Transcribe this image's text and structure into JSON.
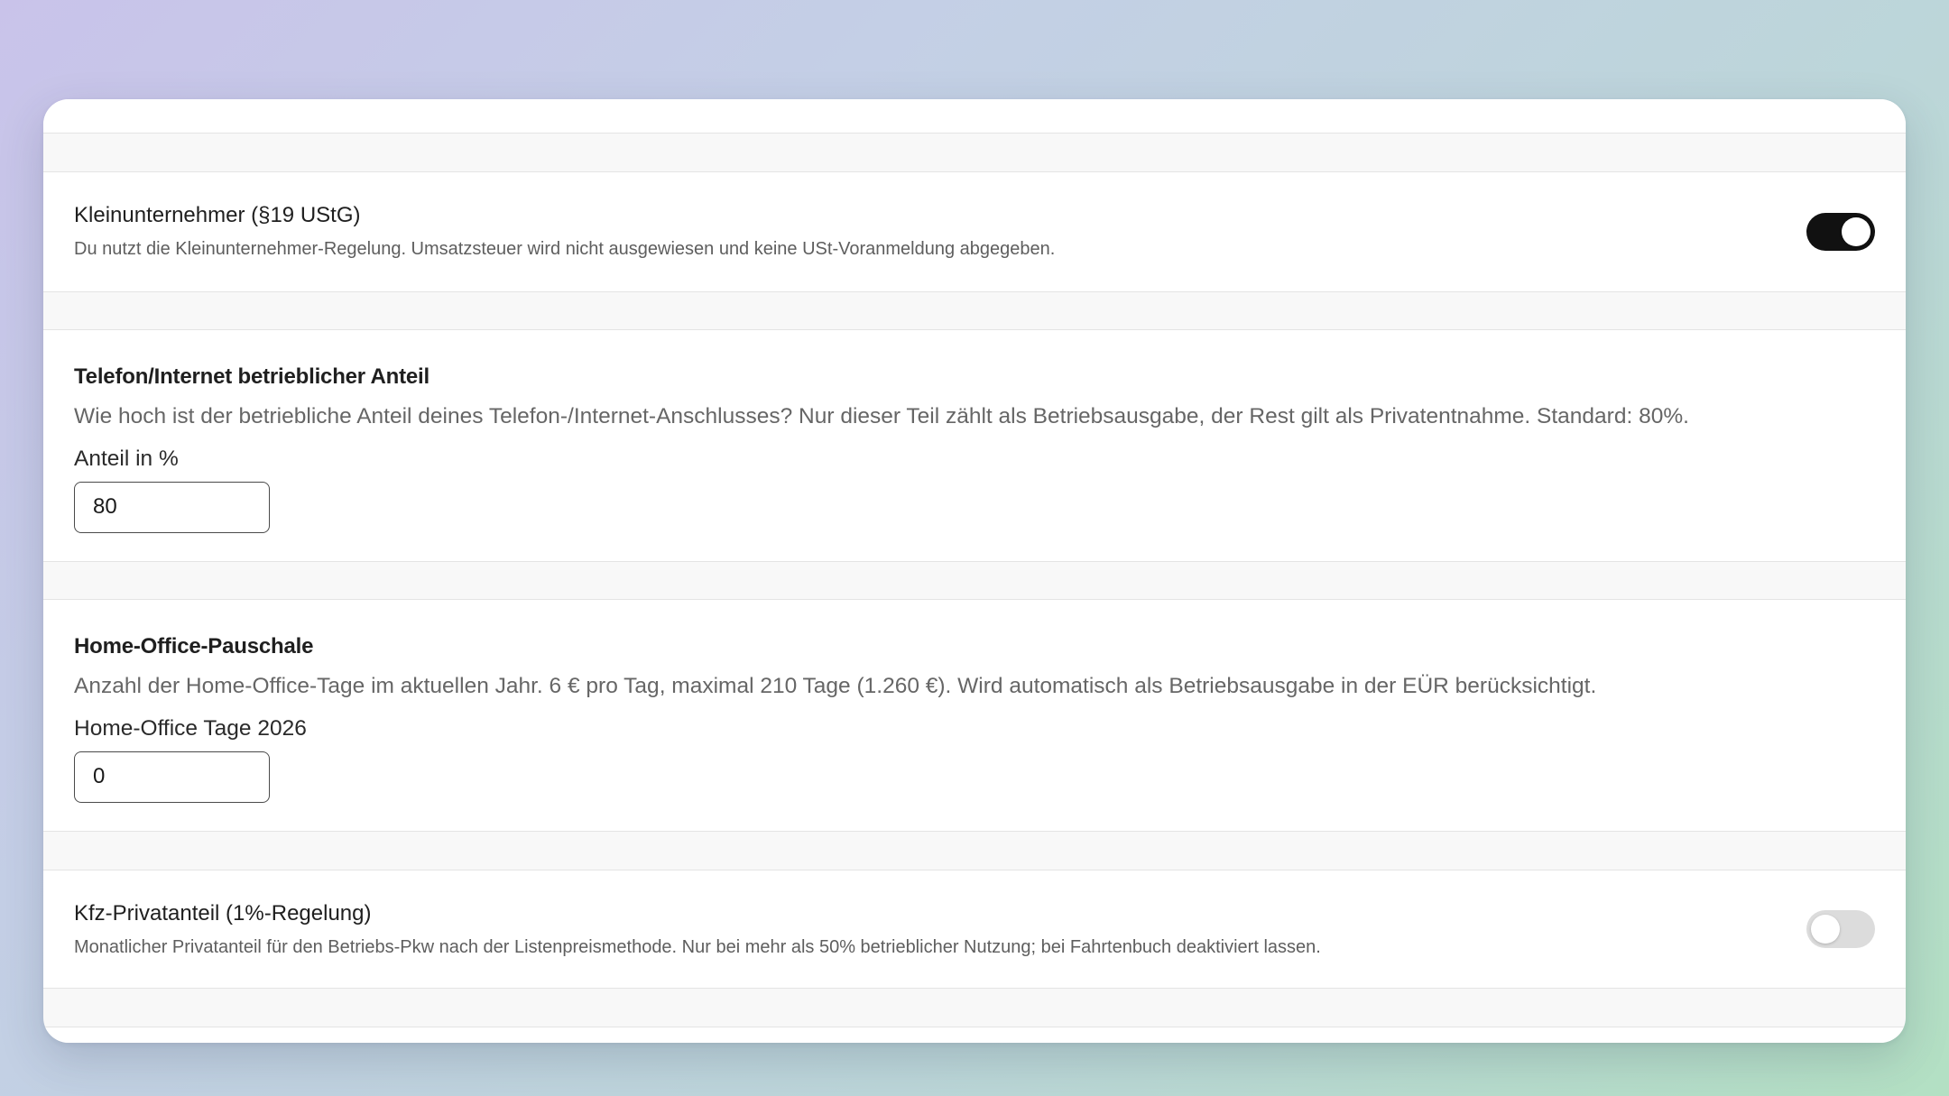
{
  "settings": {
    "kleinunternehmer": {
      "title": "Kleinunternehmer (§19 UStG)",
      "description": "Du nutzt die Kleinunternehmer-Regelung. Umsatzsteuer wird nicht ausgewiesen und keine USt-Voranmeldung abgegeben.",
      "enabled": true
    },
    "telefon": {
      "title": "Telefon/Internet betrieblicher Anteil",
      "description": "Wie hoch ist der betriebliche Anteil deines Telefon-/Internet-Anschlusses? Nur dieser Teil zählt als Betriebsausgabe, der Rest gilt als Privatentnahme. Standard: 80%.",
      "field_label": "Anteil in %",
      "value": "80"
    },
    "homeoffice": {
      "title": "Home-Office-Pauschale",
      "description": "Anzahl der Home-Office-Tage im aktuellen Jahr. 6 € pro Tag, maximal 210 Tage (1.260 €). Wird automatisch als Betriebsausgabe in der EÜR berücksichtigt.",
      "field_label": "Home-Office Tage 2026",
      "value": "0"
    },
    "kfz": {
      "title": "Kfz-Privatanteil (1%-Regelung)",
      "description": "Monatlicher Privatanteil für den Betriebs-Pkw nach der Listenpreismethode. Nur bei mehr als 50% betrieblicher Nutzung; bei Fahrtenbuch deaktiviert lassen.",
      "enabled": false
    }
  },
  "colors": {
    "toggle_on": "#111111",
    "toggle_off": "#dcdcdc"
  }
}
